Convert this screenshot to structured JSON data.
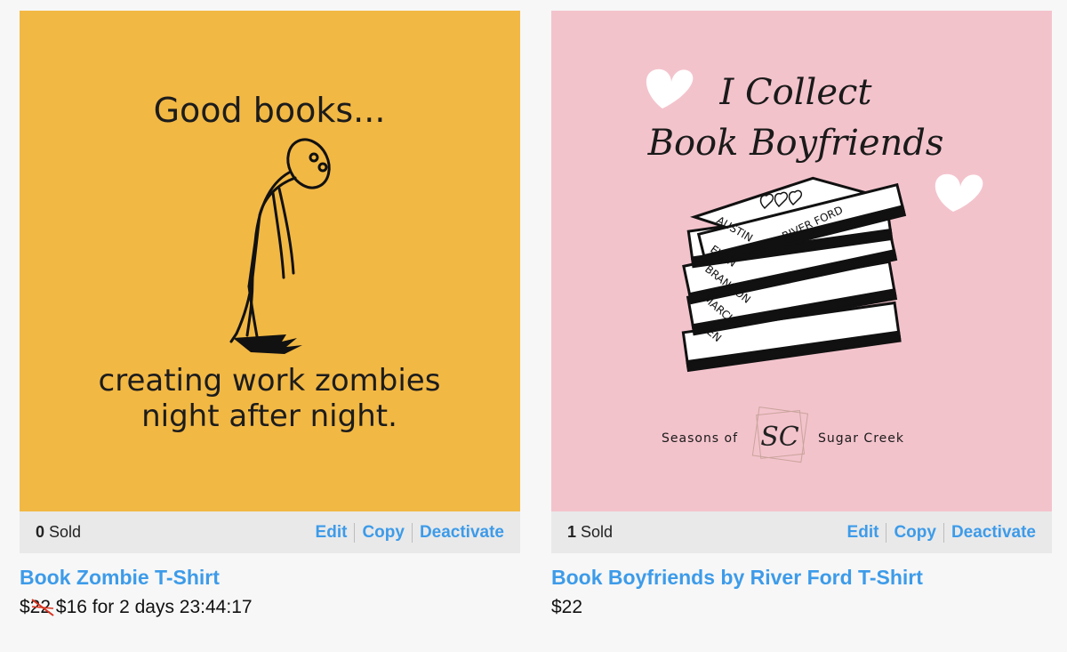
{
  "products": [
    {
      "art": {
        "headline": "Good books...",
        "line1": "creating work zombies",
        "line2": "night after night."
      },
      "sold_count": "0",
      "sold_label": "Sold",
      "actions": [
        "Edit",
        "Copy",
        "Deactivate"
      ],
      "title": "Book Zombie T-Shirt",
      "old_price": "$22",
      "sale_text": "$16 for 2 days 23:44:17",
      "colors": {
        "background": "#f2b844"
      }
    },
    {
      "art": {
        "line1": "I Collect",
        "line2": "Book Boyfriends",
        "books": [
          "AUSTIN",
          "EVAN",
          "BRANDON",
          "MARCUS",
          "BEN"
        ],
        "top_book_author": "RIVER FORD",
        "footer_left": "Seasons of",
        "footer_monogram": "SC",
        "footer_right": "Sugar Creek"
      },
      "sold_count": "1",
      "sold_label": "Sold",
      "actions": [
        "Edit",
        "Copy",
        "Deactivate"
      ],
      "title": "Book Boyfriends by River Ford T-Shirt",
      "price": "$22",
      "colors": {
        "background": "#f3c3cc"
      }
    }
  ],
  "colors": {
    "link": "#3d9be9",
    "bar": "#e9e9e9"
  }
}
